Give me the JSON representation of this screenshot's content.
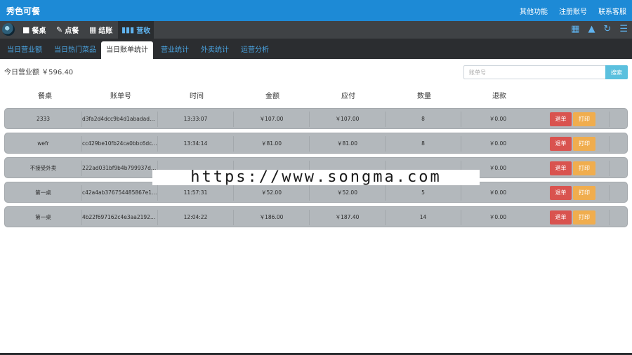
{
  "header": {
    "brand": "秀色可餐",
    "links": [
      "其他功能",
      "注册账号",
      "联系客服"
    ]
  },
  "nav": {
    "items": [
      {
        "icon": "■",
        "label": "餐桌"
      },
      {
        "icon": "✎",
        "label": "点餐"
      },
      {
        "icon": "▦",
        "label": "结账"
      },
      {
        "icon": "▮▮▮",
        "label": "营收"
      }
    ],
    "active_index": 3
  },
  "tabs": [
    "当日营业额",
    "当日热门菜品",
    "当日账单统计",
    "营业统计",
    "外卖统计",
    "运营分析"
  ],
  "active_tab": 2,
  "revenue": {
    "text": "今日营业额 ￥596.40"
  },
  "search": {
    "placeholder": "账单号",
    "button_label": "搜索"
  },
  "table": {
    "headers": [
      "餐桌",
      "账单号",
      "时间",
      "金额",
      "应付",
      "数量",
      "退款"
    ],
    "rows": [
      {
        "table": "2333",
        "bill": "d3fa2d4dcc9b4d1abadad477...",
        "time": "13:33:07",
        "amount": "￥107.00",
        "payable": "￥107.00",
        "qty": "8",
        "refund": "￥0.00"
      },
      {
        "table": "wefr",
        "bill": "cc429be10fb24ca0bbc6dc4d...",
        "time": "13:34:14",
        "amount": "￥81.00",
        "payable": "￥81.00",
        "qty": "8",
        "refund": "￥0.00"
      },
      {
        "table": "不接受外卖",
        "bill": "222ad031bf9b4b799937d64...",
        "time": "",
        "amount": "",
        "payable": "",
        "qty": "",
        "refund": "￥0.00"
      },
      {
        "table": "第一桌",
        "bill": "c42a4ab376754485867e1501...",
        "time": "11:57:31",
        "amount": "￥52.00",
        "payable": "￥52.00",
        "qty": "5",
        "refund": "￥0.00"
      },
      {
        "table": "第一桌",
        "bill": "4b22f697162c4e3aa2192b93...",
        "time": "12:04:22",
        "amount": "￥186.00",
        "payable": "￥187.40",
        "qty": "14",
        "refund": "￥0.00"
      }
    ],
    "cancel_label": "退单",
    "print_label": "打印"
  },
  "watermark": "https://www.songma.com",
  "icons": {
    "nav_right": [
      "grid-icon",
      "bell-icon",
      "refresh-icon",
      "menu-icon"
    ]
  },
  "colors": {
    "topbar": "#1d8ad6",
    "navbar": "#3f4245",
    "tabbar": "#2b2d30",
    "row_bg": "#b3b8bc",
    "cancel": "#d9534f",
    "print": "#f0ad4e",
    "search_btn": "#5bc0de"
  }
}
